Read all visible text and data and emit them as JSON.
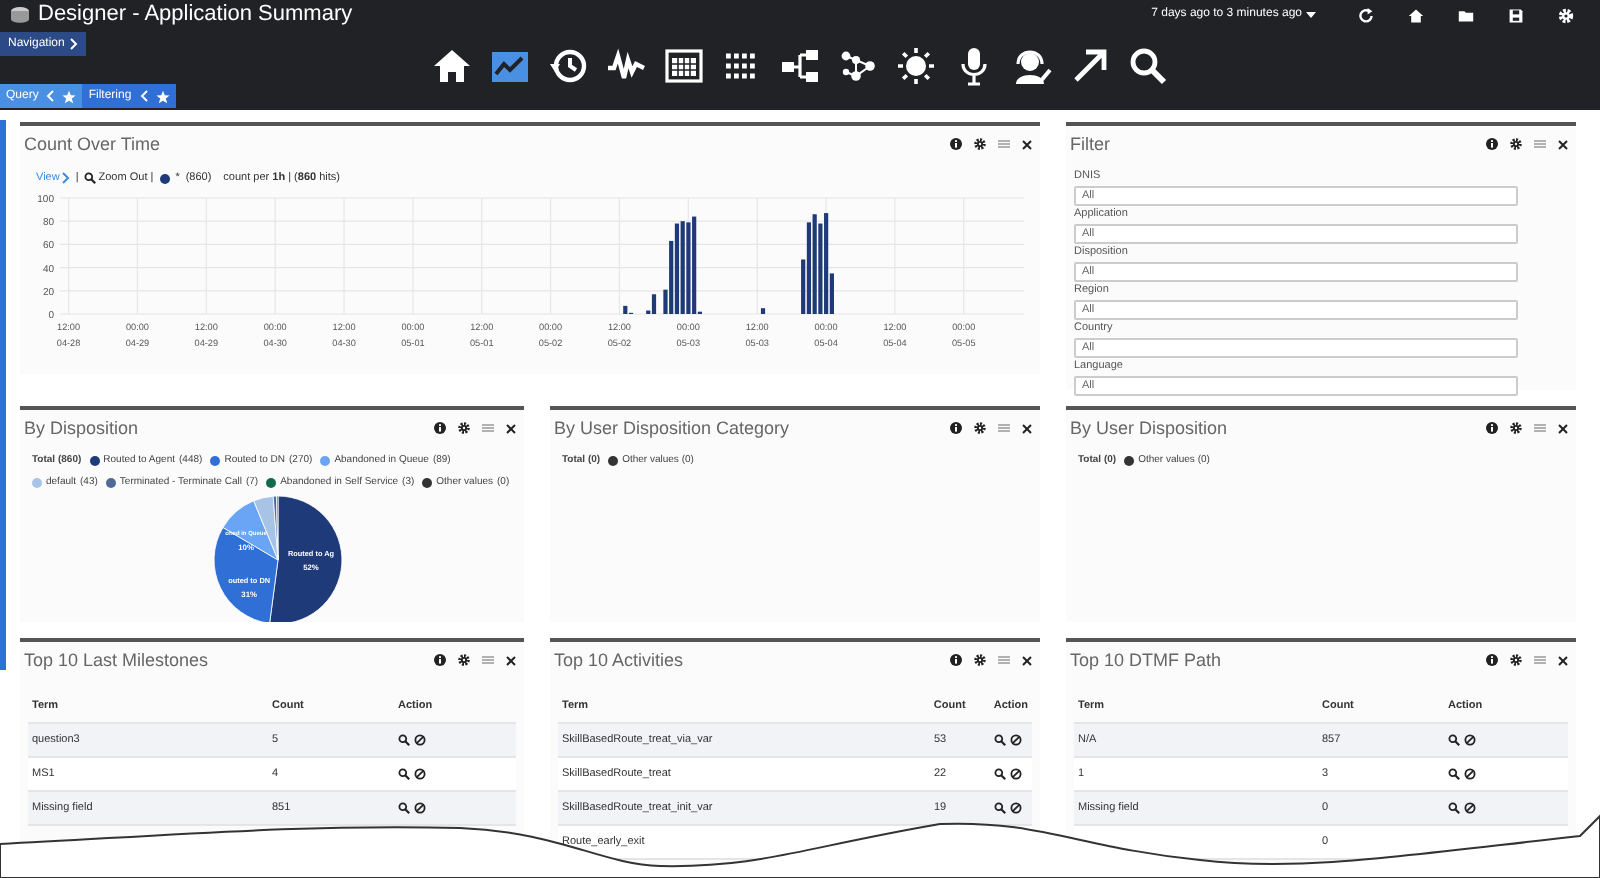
{
  "header": {
    "title": "Designer - Application Summary",
    "time_range": "7 days ago to 3 minutes ago",
    "tools": [
      {
        "kind": "refresh"
      },
      {
        "kind": "home"
      },
      {
        "kind": "folder"
      },
      {
        "kind": "save"
      },
      {
        "kind": "settings"
      }
    ]
  },
  "navigation": {
    "label": "Navigation"
  },
  "nav_icons": [
    {
      "kind": "home",
      "selected": false
    },
    {
      "kind": "trend",
      "selected": true
    },
    {
      "kind": "history",
      "selected": false
    },
    {
      "kind": "wave",
      "selected": false
    },
    {
      "kind": "calendar",
      "selected": false
    },
    {
      "kind": "grid",
      "selected": false
    },
    {
      "kind": "tree",
      "selected": false
    },
    {
      "kind": "nodes",
      "selected": false
    },
    {
      "kind": "sun",
      "selected": false
    },
    {
      "kind": "mic",
      "selected": false
    },
    {
      "kind": "headset",
      "selected": false
    },
    {
      "kind": "arrow",
      "selected": false
    },
    {
      "kind": "search",
      "selected": false
    }
  ],
  "tabs": [
    {
      "label": "Query",
      "selected": true
    },
    {
      "label": "Filtering",
      "selected": false
    }
  ],
  "count_over_time": {
    "title": "Count Over Time",
    "view": "View",
    "zoom_out": "Zoom Out |",
    "separator": "|",
    "series_count": "(860)",
    "summary": "count per **1h** | (**860** hits)",
    "chart_data": {
      "type": "bar",
      "grid": true,
      "ylim": [
        0,
        100
      ],
      "yticks": [
        0,
        20,
        40,
        60,
        80,
        100
      ],
      "categories": [
        null,
        "12:00 04-28",
        null,
        null,
        null,
        null,
        null,
        null,
        null,
        null,
        null,
        null,
        null,
        "00:00 04-29",
        null,
        null,
        null,
        null,
        null,
        null,
        null,
        null,
        null,
        null,
        null,
        "12:00 04-29",
        null,
        null,
        null,
        null,
        null,
        null,
        null,
        null,
        null,
        null,
        null,
        "00:00 04-30",
        null,
        null,
        null,
        null,
        null,
        null,
        null,
        null,
        null,
        null,
        null,
        "12:00 04-30",
        null,
        null,
        null,
        null,
        null,
        null,
        null,
        null,
        null,
        null,
        null,
        "00:00 05-01",
        null,
        null,
        null,
        null,
        null,
        null,
        null,
        null,
        null,
        null,
        null,
        "12:00 05-01",
        null,
        null,
        null,
        null,
        null,
        null,
        null,
        null,
        null,
        null,
        null,
        "00:00 05-02",
        null,
        null,
        null,
        null,
        null,
        null,
        null,
        null,
        null,
        null,
        null,
        "12:00 05-02",
        null,
        null,
        null,
        null,
        null,
        null,
        null,
        null,
        null,
        null,
        null,
        "00:00 05-03",
        null,
        null,
        null,
        null,
        null,
        null,
        null,
        null,
        null,
        null,
        null,
        "12:00 05-03",
        null,
        null,
        null,
        null,
        null,
        null,
        null,
        null,
        null,
        null,
        null,
        "00:00 05-04",
        null,
        null,
        null,
        null,
        null,
        null,
        null,
        null,
        null,
        null,
        null,
        "12:00 05-04",
        null,
        null,
        null,
        null,
        null,
        null,
        null,
        null,
        null,
        null,
        null,
        "00:00 05-05",
        null,
        null,
        null,
        null,
        null,
        null,
        null,
        null,
        null,
        null
      ],
      "series": [
        {
          "name": "*",
          "color": "#1f3a78",
          "values": [
            null,
            null,
            null,
            null,
            null,
            null,
            null,
            null,
            null,
            null,
            null,
            null,
            null,
            null,
            null,
            null,
            null,
            null,
            null,
            null,
            null,
            null,
            null,
            null,
            null,
            null,
            null,
            null,
            null,
            null,
            null,
            null,
            null,
            null,
            null,
            null,
            null,
            null,
            null,
            null,
            null,
            null,
            null,
            null,
            null,
            null,
            null,
            null,
            null,
            null,
            null,
            null,
            null,
            null,
            null,
            null,
            null,
            null,
            null,
            null,
            null,
            null,
            null,
            null,
            null,
            null,
            null,
            null,
            null,
            null,
            null,
            null,
            null,
            null,
            null,
            null,
            null,
            null,
            null,
            null,
            null,
            null,
            null,
            null,
            null,
            null,
            null,
            null,
            null,
            null,
            null,
            null,
            null,
            null,
            null,
            null,
            null,
            null,
            7,
            1,
            null,
            null,
            3,
            17,
            null,
            21,
            63,
            78,
            80,
            79,
            84,
            2,
            null,
            null,
            null,
            null,
            null,
            null,
            null,
            null,
            null,
            null,
            5,
            null,
            null,
            null,
            null,
            null,
            null,
            47,
            79,
            86,
            78,
            87,
            35,
            null,
            null,
            null,
            null,
            null,
            null,
            null,
            null,
            null,
            null,
            null,
            null,
            null,
            null,
            null,
            null,
            null,
            null,
            null,
            null,
            null,
            null,
            null,
            null,
            null,
            null,
            null,
            null,
            null,
            null,
            null,
            null,
            null
          ]
        }
      ]
    }
  },
  "filter": {
    "title": "Filter",
    "fields": [
      {
        "label": "DNIS",
        "value": "All"
      },
      {
        "label": "Application",
        "value": "All"
      },
      {
        "label": "Disposition",
        "value": "All"
      },
      {
        "label": "Region",
        "value": "All"
      },
      {
        "label": "Country",
        "value": "All"
      },
      {
        "label": "Language",
        "value": "All"
      }
    ]
  },
  "by_disposition": {
    "title": "By Disposition",
    "total": "Total (860)",
    "legend": [
      {
        "count": "(448)",
        "color": "#1f3a78"
      },
      {
        "count": "(270)",
        "color": "#2f6fd6"
      },
      {
        "count": "(89)",
        "color": "#6aa5f5"
      },
      {
        "count": "(43)",
        "color": "#a7c4e6"
      },
      {
        "count": "(7)",
        "color": "#4f6a94"
      },
      {
        "count": "(3)",
        "color": "#136b4a"
      },
      {
        "count": "(0)",
        "color": "#333333"
      }
    ],
    "slice_labels": [
      {
        "name": "oned in Queue",
        "percent": "10%"
      },
      {
        "name": "Routed to Ag",
        "percent": "52%"
      },
      {
        "name": "outed to DN",
        "percent": "31%"
      }
    ],
    "chart_data": {
      "type": "pie",
      "categories": [
        "Routed to Agent",
        "Routed to DN",
        "Abandoned in Queue",
        "default",
        "Terminated - Terminate Call",
        "Abandoned in Self Service",
        "Other values"
      ],
      "values": [
        52.1,
        31.4,
        10.3,
        5.0,
        0.8,
        0.4,
        0
      ]
    }
  },
  "by_user_disposition_category": {
    "title": "By User Disposition Category",
    "total": "Total (0)",
    "legend": [
      {
        "label": "Other values (0)",
        "color": "#333333"
      }
    ]
  },
  "by_user_disposition": {
    "title": "By User Disposition",
    "total": "Total (0)",
    "legend": [
      {
        "label": "Other values (0)",
        "color": "#333333"
      }
    ]
  },
  "tables": [
    {
      "title": "Top 10 Last Milestones",
      "columns": [
        "Term",
        "Count",
        "Action"
      ],
      "rows": [
        {
          "term": "question3",
          "count": "5"
        },
        {
          "term": "MS1",
          "count": "4"
        },
        {
          "term": "Missing field",
          "count": "851"
        }
      ]
    },
    {
      "title": "Top 10 Activities",
      "columns": [
        "Term",
        "Count",
        "Action"
      ],
      "rows": [
        {
          "term": "SkillBasedRoute_treat_via_var",
          "count": "53"
        },
        {
          "term": "SkillBasedRoute_treat",
          "count": "22"
        },
        {
          "term": "SkillBasedRoute_treat_init_var",
          "count": "19"
        },
        {
          "term": "Route_early_exit"
        }
      ]
    },
    {
      "title": "Top 10 DTMF Path",
      "columns": [
        "Term",
        "Count",
        "Action"
      ],
      "rows": [
        {
          "term": "N/A",
          "count": "857"
        },
        {
          "term": "1",
          "count": "3"
        },
        {
          "term": "Missing field",
          "count": "0"
        },
        {
          "count": "0"
        }
      ]
    }
  ]
}
